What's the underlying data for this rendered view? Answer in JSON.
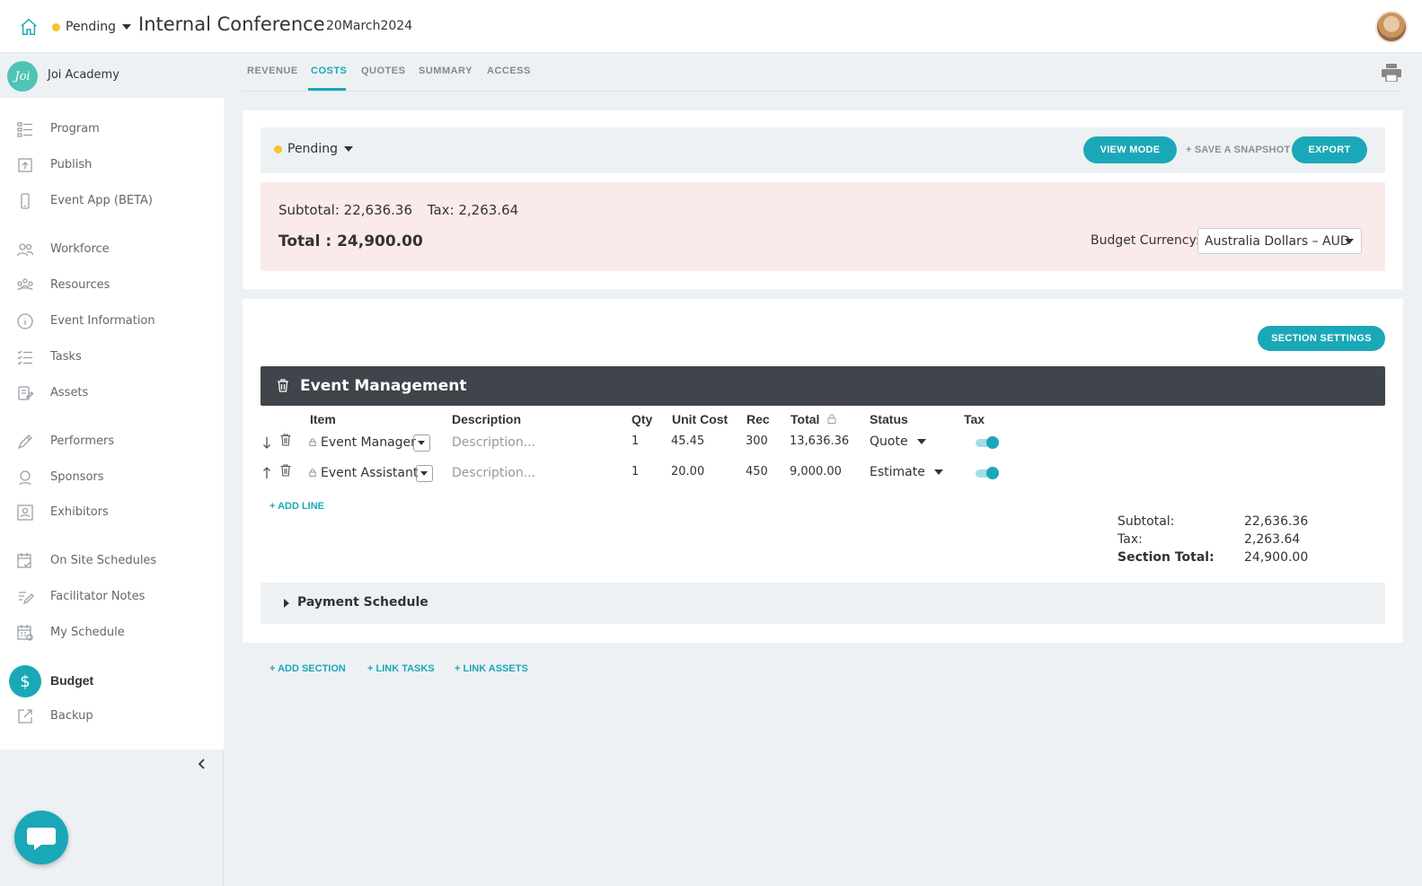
{
  "header": {
    "status": "Pending",
    "status_color": "#f5c32b",
    "event_title": "Internal Conference",
    "event_date": "20March2024"
  },
  "sidebar": {
    "org_logo_text": "Joi",
    "org_name": "Joi Academy",
    "items": [
      {
        "label": "Program",
        "icon": "program-icon"
      },
      {
        "label": "Publish",
        "icon": "publish-icon"
      },
      {
        "label": "Event App (BETA)",
        "icon": "phone-icon"
      },
      {
        "label": "Workforce",
        "icon": "people-icon"
      },
      {
        "label": "Resources",
        "icon": "resources-icon"
      },
      {
        "label": "Event Information",
        "icon": "info-icon"
      },
      {
        "label": "Tasks",
        "icon": "tasks-icon"
      },
      {
        "label": "Assets",
        "icon": "assets-icon"
      },
      {
        "label": "Performers",
        "icon": "pen-icon"
      },
      {
        "label": "Sponsors",
        "icon": "sponsor-icon"
      },
      {
        "label": "Exhibitors",
        "icon": "exhibitor-icon"
      },
      {
        "label": "On Site Schedules",
        "icon": "calendar-check-icon"
      },
      {
        "label": "Facilitator Notes",
        "icon": "notes-icon"
      },
      {
        "label": "My Schedule",
        "icon": "calendar-icon"
      },
      {
        "label": "Budget",
        "icon": "dollar-icon",
        "active": true
      },
      {
        "label": "Backup",
        "icon": "external-link-icon"
      }
    ]
  },
  "tabs": [
    {
      "label": "REVENUE"
    },
    {
      "label": "COSTS",
      "active": true
    },
    {
      "label": "QUOTES"
    },
    {
      "label": "SUMMARY"
    },
    {
      "label": "ACCESS"
    }
  ],
  "budget": {
    "status": "Pending",
    "view_mode_label": "VIEW MODE",
    "save_snapshot_label": "+ SAVE A SNAPSHOT",
    "export_label": "EXPORT",
    "subtotal_text": "Subtotal: 22,636.36",
    "tax_text": "Tax: 2,263.64",
    "total_text": "Total : 24,900.00",
    "currency_label": "Budget Currency:",
    "currency_value": "Australia Dollars – AUD"
  },
  "section": {
    "settings_label": "SECTION SETTINGS",
    "title": "Event Management",
    "columns": {
      "item": "Item",
      "description": "Description",
      "qty": "Qty",
      "unit_cost": "Unit Cost",
      "rec": "Rec",
      "total": "Total",
      "status": "Status",
      "tax": "Tax"
    },
    "description_placeholder": "Description...",
    "rows": [
      {
        "item": "Event Manager",
        "qty": "1",
        "unit_cost": "45.45",
        "rec": "300",
        "total": "13,636.36",
        "status": "Quote",
        "tax": true,
        "arrow": "down"
      },
      {
        "item": "Event Assistant",
        "qty": "1",
        "unit_cost": "20.00",
        "rec": "450",
        "total": "9,000.00",
        "status": "Estimate",
        "tax": true,
        "arrow": "up"
      }
    ],
    "add_line_label": "+ ADD LINE",
    "totals": {
      "subtotal_label": "Subtotal:",
      "subtotal_value": "22,636.36",
      "tax_label": "Tax:",
      "tax_value": "2,263.64",
      "section_total_label": "Section Total:",
      "section_total_value": "24,900.00"
    },
    "payment_schedule_label": "Payment Schedule"
  },
  "footer_links": {
    "add_section": "+ ADD SECTION",
    "link_tasks": "+ LINK TASKS",
    "link_assets": "+ LINK ASSETS"
  },
  "colors": {
    "accent": "#1aa8b8",
    "pending": "#f5c32b",
    "summary_bg": "#fbeaea",
    "section_header_bg": "#3f454b"
  }
}
